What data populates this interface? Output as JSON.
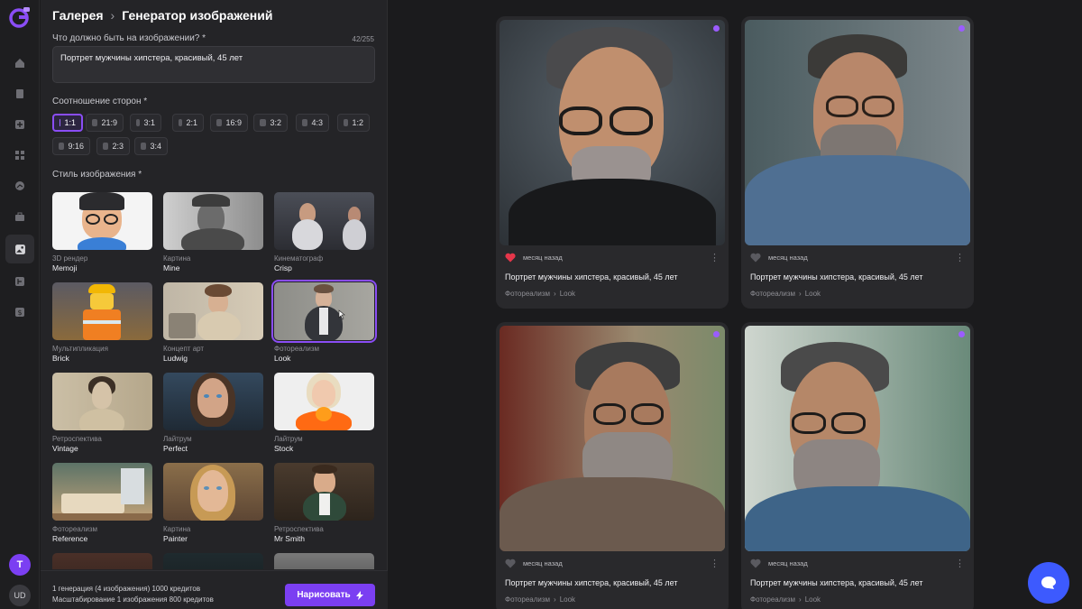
{
  "breadcrumb": {
    "root": "Галерея",
    "current": "Генератор изображений"
  },
  "prompt": {
    "label": "Что должно быть на изображении?",
    "required_mark": "*",
    "counter": "42/255",
    "value": "Портрет мужчины хипстера, красивый, 45 лет"
  },
  "aspect": {
    "label": "Соотношение сторон",
    "required_mark": "*",
    "options": [
      "1:1",
      "21:9",
      "3:1",
      "2:1",
      "16:9",
      "3:2",
      "4:3",
      "1:2",
      "9:16",
      "2:3",
      "3:4"
    ],
    "selected": "1:1"
  },
  "style": {
    "label": "Стиль изображения",
    "required_mark": "*",
    "tiles": [
      {
        "category": "3D рендер",
        "name": "Memoji"
      },
      {
        "category": "Картина",
        "name": "Mine"
      },
      {
        "category": "Кинематограф",
        "name": "Crisp"
      },
      {
        "category": "Мультипликация",
        "name": "Brick"
      },
      {
        "category": "Концепт арт",
        "name": "Ludwig"
      },
      {
        "category": "Фотореализм",
        "name": "Look"
      },
      {
        "category": "Ретроспектива",
        "name": "Vintage"
      },
      {
        "category": "Лайтрум",
        "name": "Perfect"
      },
      {
        "category": "Лайтрум",
        "name": "Stock"
      },
      {
        "category": "Фотореализм",
        "name": "Reference"
      },
      {
        "category": "Картина",
        "name": "Painter"
      },
      {
        "category": "Ретроспектива",
        "name": "Mr Smith"
      }
    ],
    "selected": "Look"
  },
  "footer": {
    "line1": "1 генерация (4 изображения) 1000 кредитов",
    "line2": "Масштабирование 1 изображения 800 кредитов",
    "draw_button": "Нарисовать"
  },
  "rail": {
    "avatar_letter": "T",
    "user_initials": "UD"
  },
  "results": [
    {
      "time": "месяц назад",
      "liked": true,
      "title": "Портрет мужчины хипстера, красивый, 45 лет",
      "tag1": "Фотореализм",
      "tag2": "Look"
    },
    {
      "time": "месяц назад",
      "liked": false,
      "title": "Портрет мужчины хипстера, красивый, 45 лет",
      "tag1": "Фотореализм",
      "tag2": "Look"
    },
    {
      "time": "месяц назад",
      "liked": false,
      "title": "Портрет мужчины хипстера, красивый, 45 лет",
      "tag1": "Фотореализм",
      "tag2": "Look"
    },
    {
      "time": "месяц назад",
      "liked": false,
      "title": "Портрет мужчины хипстера, красивый, 45 лет",
      "tag1": "Фотореализм",
      "tag2": "Look"
    }
  ],
  "colors": {
    "accent": "#7b3ff2",
    "liked": "#e5364a",
    "chat": "#3d5afe"
  }
}
